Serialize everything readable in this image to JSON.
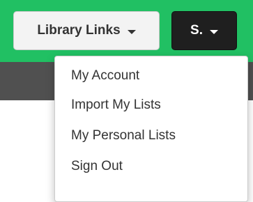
{
  "header": {
    "library_links_label": "Library Links",
    "user_menu_label": "S.",
    "colors": {
      "header_green": "#21c063",
      "dark_band": "#505050",
      "user_button_bg": "#1f1f1f"
    }
  },
  "dropdown": {
    "items": [
      {
        "label": "My Account"
      },
      {
        "label": "Import My Lists"
      },
      {
        "label": "My Personal Lists"
      },
      {
        "label": "Sign Out"
      }
    ]
  },
  "icons": {
    "library_caret": "caret-down",
    "user_caret": "caret-down"
  }
}
